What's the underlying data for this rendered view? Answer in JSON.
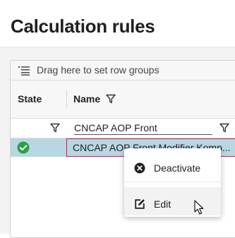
{
  "page": {
    "title": "Calculation rules"
  },
  "grid": {
    "group_bar_text": "Drag here to set row groups",
    "columns": {
      "state": "State",
      "name": "Name"
    },
    "filter": {
      "name_value": "CNCAP AOP Front"
    },
    "rows": [
      {
        "state": "active",
        "name": "CNCAP AOP Front Modifier Komp..."
      }
    ]
  },
  "context_menu": {
    "items": [
      {
        "label": "Deactivate",
        "icon": "close-circle-icon"
      },
      {
        "label": "Edit",
        "icon": "edit-icon"
      }
    ]
  },
  "colors": {
    "selected_row": "#b8d7e3",
    "active_status": "#2e9e4a",
    "cell_focus_border": "#9c3b4b"
  }
}
